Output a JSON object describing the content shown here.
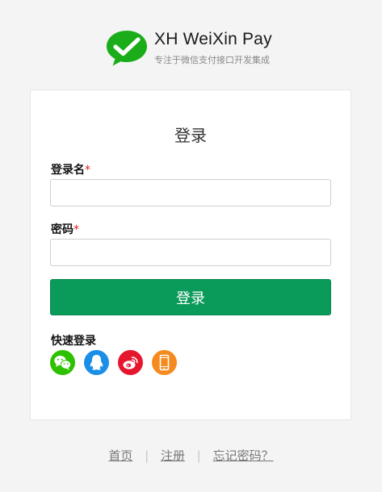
{
  "brand": {
    "title": "XH WeiXin Pay",
    "subtitle": "专注于微信支付接口开发集成",
    "logo_icon": "wechat-pay-logo",
    "color": "#1aad19"
  },
  "login": {
    "title": "登录",
    "username_label": "登录名",
    "username_required": "*",
    "username_value": "",
    "password_label": "密码",
    "password_required": "*",
    "password_value": "",
    "submit_label": "登录",
    "button_color": "#0a9a5a"
  },
  "quick_login": {
    "title": "快速登录",
    "items": [
      {
        "icon": "wechat-icon",
        "color": "#2dc100"
      },
      {
        "icon": "qq-icon",
        "color": "#1b8fe8"
      },
      {
        "icon": "weibo-icon",
        "color": "#e6162d"
      },
      {
        "icon": "mobile-phone-icon",
        "color": "#f58a1f"
      }
    ]
  },
  "footer": {
    "links": [
      "首页",
      "注册",
      "忘记密码？"
    ]
  }
}
